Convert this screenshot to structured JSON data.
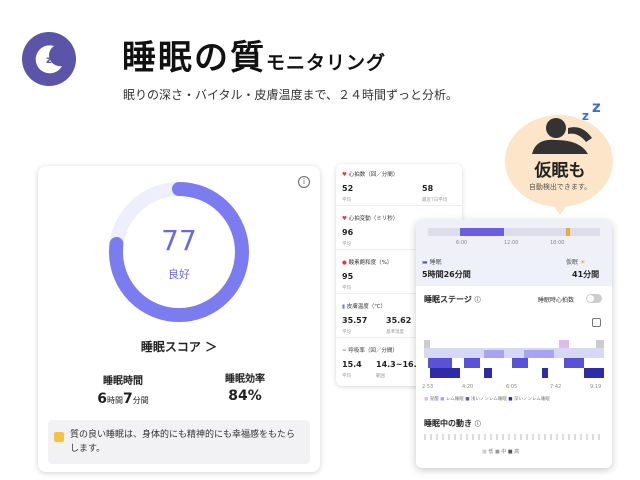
{
  "header": {
    "title_main": "睡眠の質",
    "title_sub": "モニタリング",
    "subtitle": "眠りの深さ・バイタル・皮膚温度まで、２４時間ずっと分析。",
    "logo_letter": "z"
  },
  "score_card": {
    "score": "77",
    "score_label": "良好",
    "score_fraction": 0.77,
    "score_link": "睡眠スコア ＞",
    "sleep_time_label": "睡眠時間",
    "sleep_time_h": "6",
    "sleep_time_h_unit": "時間",
    "sleep_time_m": "7",
    "sleep_time_m_unit": "分間",
    "efficiency_label": "睡眠効率",
    "efficiency_value": "84%",
    "tip_text": "質の良い睡眠は、身体的にも精神的にも幸福感をもたらします。",
    "accent": "#7b7cf0",
    "ring_bg": "#eeeefc"
  },
  "vitals": [
    {
      "title": "心拍数（回／分間）",
      "v1": "52",
      "c1": "平均",
      "v2": "58",
      "c2": "最近7日平均"
    },
    {
      "title": "心拍変動（ミリ秒）",
      "v1": "96",
      "c1": "平均",
      "v2": "",
      "c2": ""
    },
    {
      "title": "酸素飽和度（%）",
      "v1": "95",
      "c1": "平均",
      "v2": "",
      "c2": ""
    },
    {
      "title": "皮膚温度（℃）",
      "v1": "35.57",
      "c1": "平均",
      "v2": "35.62",
      "c2": "基準温度"
    },
    {
      "title": "呼吸率（回／分間）",
      "v1": "15.4",
      "c1": "平均",
      "v2": "14.3~16.5",
      "c2": "範囲"
    }
  ],
  "nap_bubble": {
    "title": "仮眠も",
    "caption": "自動検出できます。",
    "bg": "#fce5c8"
  },
  "detail_card": {
    "timeline_ticks": [
      "6:00",
      "12:00",
      "18:00"
    ],
    "sleep_label": "睡眠",
    "sleep_value": "5時間26分間",
    "nap_label": "仮眠",
    "nap_value": "41分間",
    "stages_title": "睡眠ステージ",
    "hr_toggle_label": "睡眠時心拍数",
    "stage_times": [
      "2:53",
      "4:20",
      "6:05",
      "7:42",
      "9:19"
    ],
    "stage_legend": [
      "覚醒",
      "レム睡眠",
      "浅いノンレム睡眠",
      "深いノンレム睡眠"
    ],
    "movement_title": "睡眠中の動き",
    "movement_legend": [
      "低",
      "中",
      "高"
    ]
  }
}
